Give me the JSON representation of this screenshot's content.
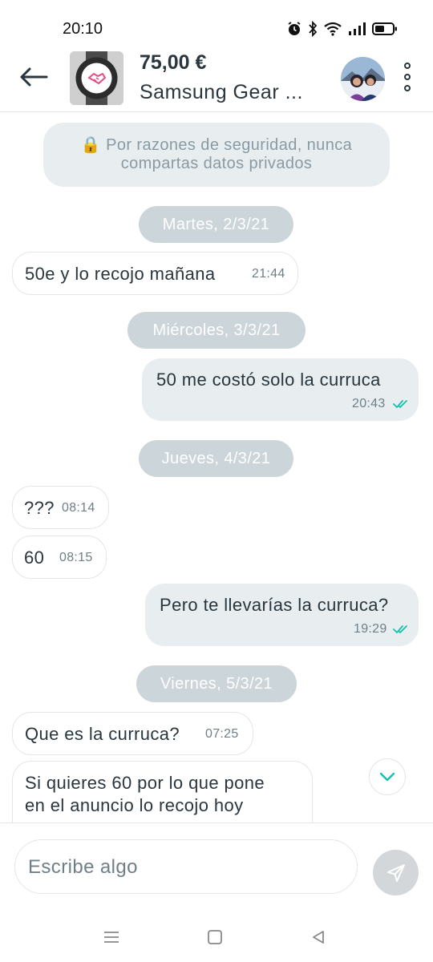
{
  "status_bar": {
    "time": "20:10"
  },
  "header": {
    "price": "75,00 €",
    "title": "Samsung Gear ..."
  },
  "notice": {
    "line1": "🔒 Por razones de seguridad, nunca",
    "line2": "compartas datos privados"
  },
  "dates": [
    "Martes, 2/3/21",
    "Miércoles, 3/3/21",
    "Jueves, 4/3/21",
    "Viernes, 5/3/21"
  ],
  "messages": [
    {
      "direction": "in",
      "text": "50e y lo recojo mañana",
      "time": "21:44"
    },
    {
      "direction": "out",
      "text": "50 me costó solo la curruca",
      "time": "20:43",
      "read": true
    },
    {
      "direction": "in",
      "text": "???",
      "time": "08:14"
    },
    {
      "direction": "in",
      "text": "60",
      "time": "08:15"
    },
    {
      "direction": "out",
      "text": "Pero te llevarías la curruca?",
      "time": "19:29",
      "read": true
    },
    {
      "direction": "in",
      "text": "Que es la curruca?",
      "time": "07:25"
    },
    {
      "direction": "in",
      "text_line1": "Si quieres 60 por lo que pone",
      "text_line2": "en el anuncio lo recojo hoy"
    }
  ],
  "composer": {
    "placeholder": "Escribe algo"
  },
  "colors": {
    "accent": "#13c1ac",
    "text": "#29363d",
    "bubble_out": "#e8edef",
    "date_pill": "#ccd5da",
    "brand_pink": "#e64b86"
  },
  "icons": {
    "status": [
      "alarm-icon",
      "bluetooth-icon",
      "wifi-icon",
      "signal-icon",
      "battery-icon"
    ],
    "header": [
      "back-arrow-icon",
      "more-vertical-icon"
    ],
    "chat": [
      "lock-icon",
      "double-check-icon",
      "chevron-down-icon"
    ],
    "composer": [
      "send-icon"
    ],
    "navigation": [
      "menu-icon",
      "home-icon",
      "back-icon"
    ]
  }
}
